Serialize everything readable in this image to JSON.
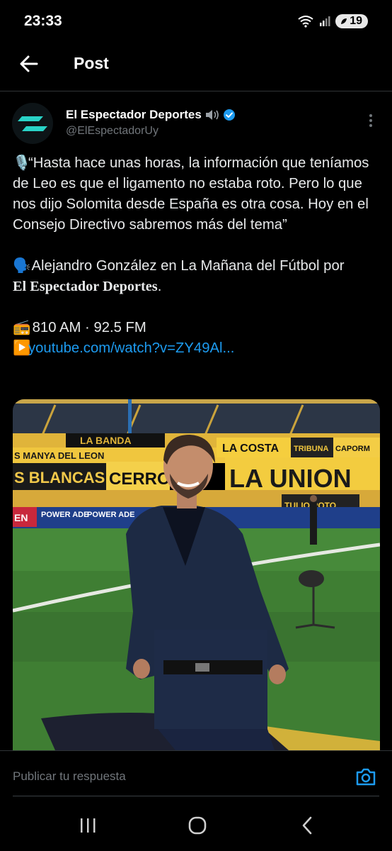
{
  "status_bar": {
    "time": "23:33",
    "battery": "19"
  },
  "header": {
    "title": "Post"
  },
  "author": {
    "name": "El Espectador Deportes",
    "handle": "@ElEspectadorUy"
  },
  "tweet": {
    "quote_emoji": "🎙️",
    "quote": "“Hasta hace unas horas, la información que teníamos de Leo es que el ligamento no estaba roto. Pero lo que nos dijo Solomita desde España es otra cosa. Hoy en el Consejo Directivo sabremos más del tema”",
    "speaker_emoji": "🗣️",
    "speaker_text": "Alejandro González en La Mañana del Fútbol por",
    "brand": "El Espectador Deportes",
    "brand_suffix": ".",
    "radio_emoji": "📻",
    "radio_text": "810 AM · 92.5 FM",
    "play_emoji": "▶️",
    "link_text": "youtube.com/watch?v=ZY49Al..."
  },
  "media": {
    "banners": [
      "LA BANDA",
      "S MANYA DEL LEON",
      "LA COSTA",
      "TRIBUNA",
      "CAPORM",
      "S BLANCAS",
      "CERRO",
      "LA UNION",
      "TULIO POTO",
      "POWER ADE",
      "POWER ADE",
      "EN"
    ]
  },
  "reply": {
    "placeholder": "Publicar tu respuesta"
  }
}
